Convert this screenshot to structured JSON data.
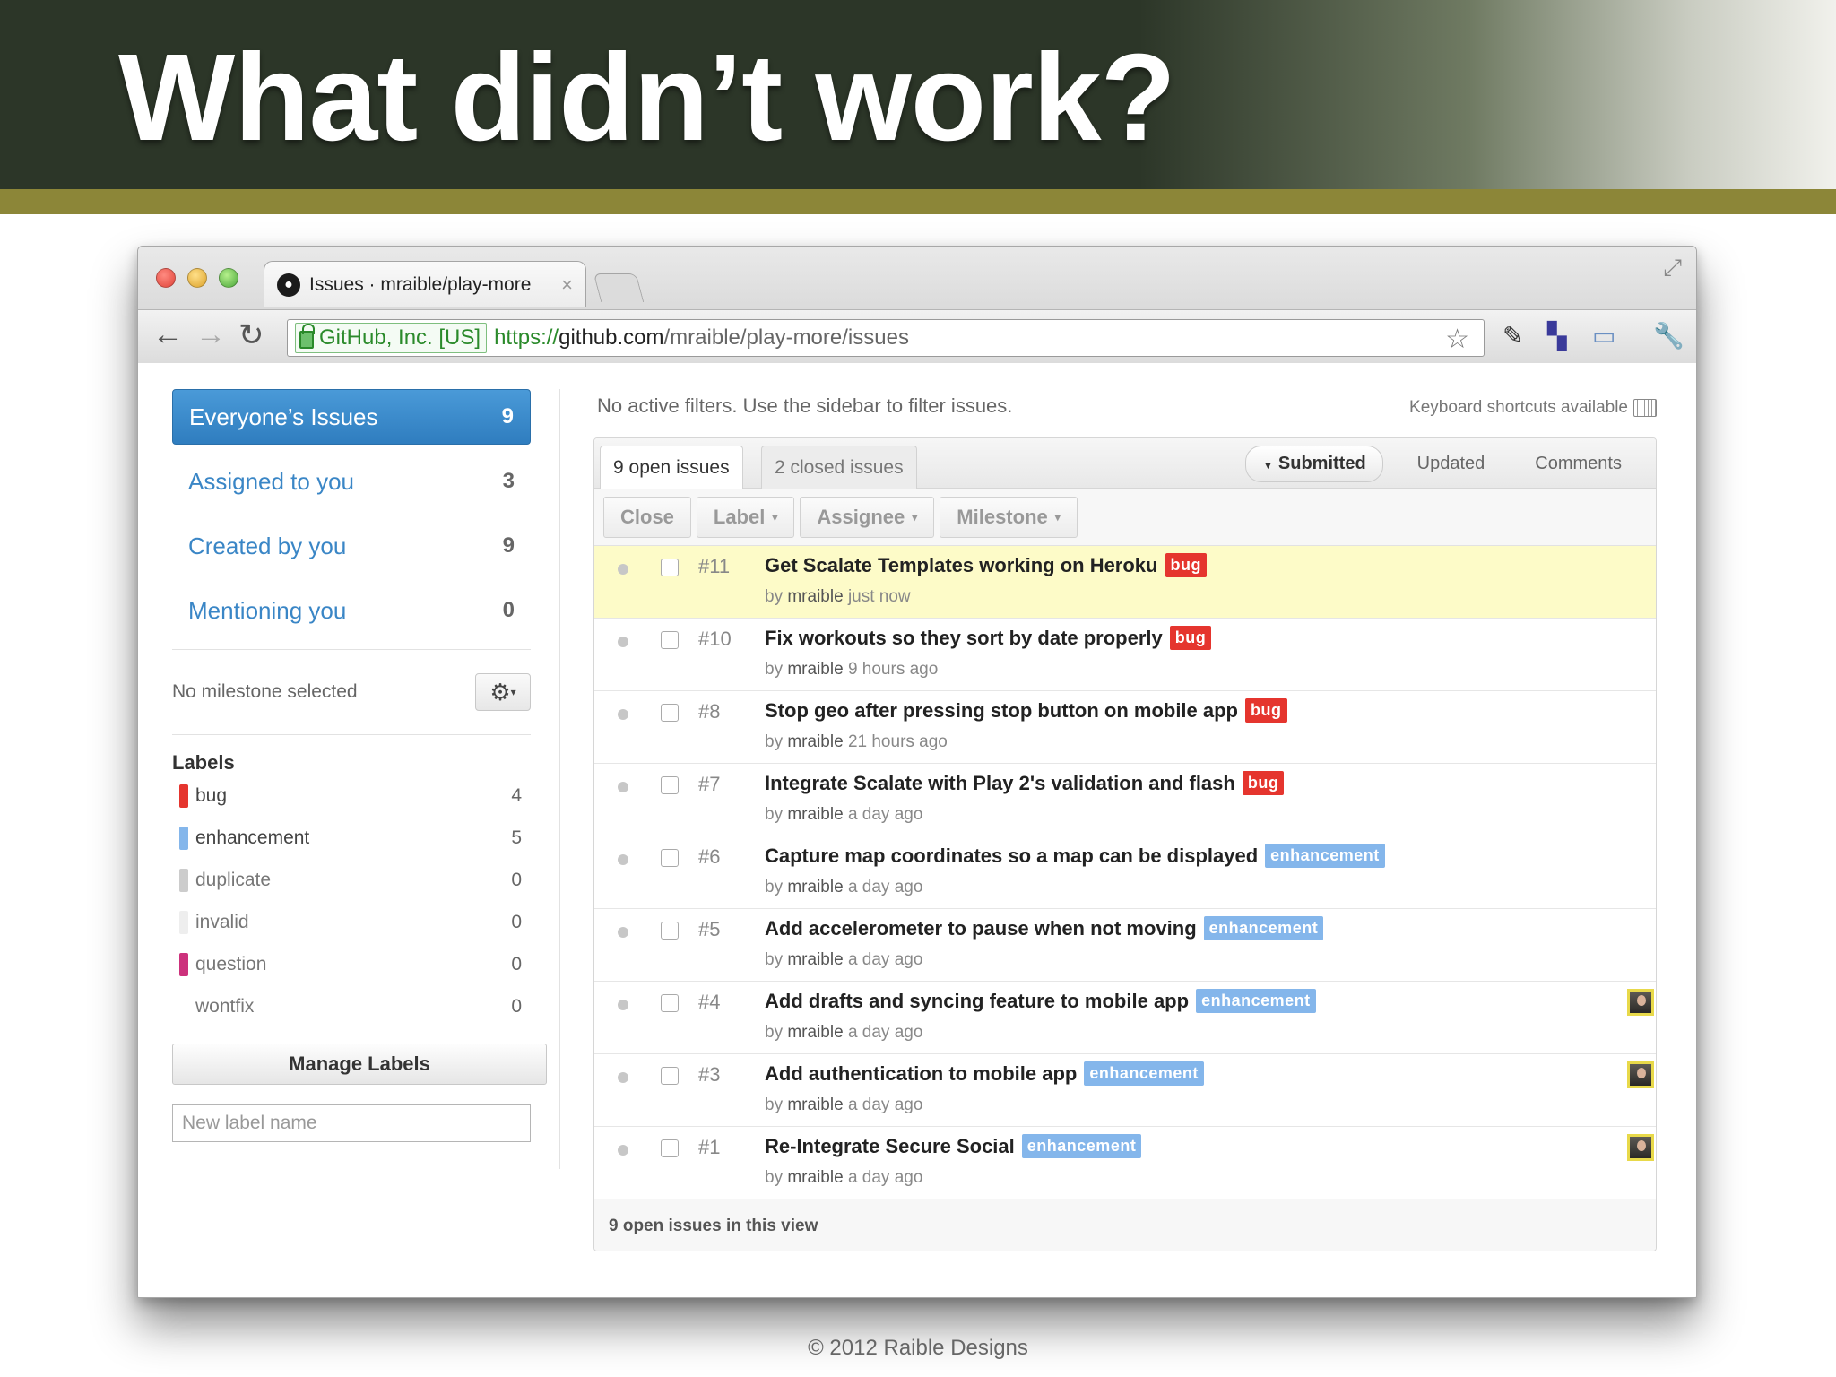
{
  "slide": {
    "title": "What didn’t work?",
    "footer": "© 2012 Raible Designs"
  },
  "browser": {
    "tab_title": "Issues · mraible/play-more",
    "tab_close": "×",
    "security_badge": "GitHub, Inc. [US]",
    "url_scheme": "https://",
    "url_host": "github.com",
    "url_path": "/mraible/play-more/issues",
    "icons": {
      "back": "back-arrow-icon",
      "forward": "forward-arrow-icon",
      "reload": "reload-icon",
      "star": "bookmark-star-icon",
      "wrench": "wrench-icon"
    }
  },
  "sidebar": {
    "filters": [
      {
        "label": "Everyone’s Issues",
        "count": "9",
        "active": true
      },
      {
        "label": "Assigned to you",
        "count": "3",
        "active": false
      },
      {
        "label": "Created by you",
        "count": "9",
        "active": false
      },
      {
        "label": "Mentioning you",
        "count": "0",
        "active": false
      }
    ],
    "milestone": "No milestone selected",
    "labels_title": "Labels",
    "labels": [
      {
        "name": "bug",
        "count": "4",
        "color": "#e5352e"
      },
      {
        "name": "enhancement",
        "count": "5",
        "color": "#84b6eb"
      },
      {
        "name": "duplicate",
        "count": "0",
        "color": "#cccccc"
      },
      {
        "name": "invalid",
        "count": "0",
        "color": "#e6e6e6"
      },
      {
        "name": "question",
        "count": "0",
        "color": "#cc317c"
      },
      {
        "name": "wontfix",
        "count": "0",
        "color": "#ffffff"
      }
    ],
    "manage_labels": "Manage Labels",
    "new_label_placeholder": "New label name"
  },
  "main": {
    "filter_note": "No active filters. Use the sidebar to filter issues.",
    "keyboard_note": "Keyboard shortcuts available",
    "tabs": {
      "open": "9 open issues",
      "closed": "2 closed issues"
    },
    "sort": {
      "submitted": "Submitted",
      "updated": "Updated",
      "comments": "Comments"
    },
    "actions": {
      "close": "Close",
      "label": "Label",
      "assignee": "Assignee",
      "milestone": "Milestone"
    },
    "issues": [
      {
        "number": "#11",
        "title": "Get Scalate Templates working on Heroku",
        "tag": "bug",
        "author": "mraible",
        "time": "just now",
        "avatar": false,
        "highlight": true
      },
      {
        "number": "#10",
        "title": "Fix workouts so they sort by date properly",
        "tag": "bug",
        "author": "mraible",
        "time": "9 hours ago",
        "avatar": false,
        "highlight": false
      },
      {
        "number": "#8",
        "title": "Stop geo after pressing stop button on mobile app",
        "tag": "bug",
        "author": "mraible",
        "time": "21 hours ago",
        "avatar": false,
        "highlight": false
      },
      {
        "number": "#7",
        "title": "Integrate Scalate with Play 2's validation and flash",
        "tag": "bug",
        "author": "mraible",
        "time": "a day ago",
        "avatar": false,
        "highlight": false
      },
      {
        "number": "#6",
        "title": "Capture map coordinates so a map can be displayed",
        "tag": "enhancement",
        "author": "mraible",
        "time": "a day ago",
        "avatar": false,
        "highlight": false
      },
      {
        "number": "#5",
        "title": "Add accelerometer to pause when not moving",
        "tag": "enhancement",
        "author": "mraible",
        "time": "a day ago",
        "avatar": false,
        "highlight": false
      },
      {
        "number": "#4",
        "title": "Add drafts and syncing feature to mobile app",
        "tag": "enhancement",
        "author": "mraible",
        "time": "a day ago",
        "avatar": true,
        "highlight": false
      },
      {
        "number": "#3",
        "title": "Add authentication to mobile app",
        "tag": "enhancement",
        "author": "mraible",
        "time": "a day ago",
        "avatar": true,
        "highlight": false
      },
      {
        "number": "#1",
        "title": "Re-Integrate Secure Social",
        "tag": "enhancement",
        "author": "mraible",
        "time": "a day ago",
        "avatar": true,
        "highlight": false
      }
    ],
    "footer": "9 open issues in this view"
  }
}
